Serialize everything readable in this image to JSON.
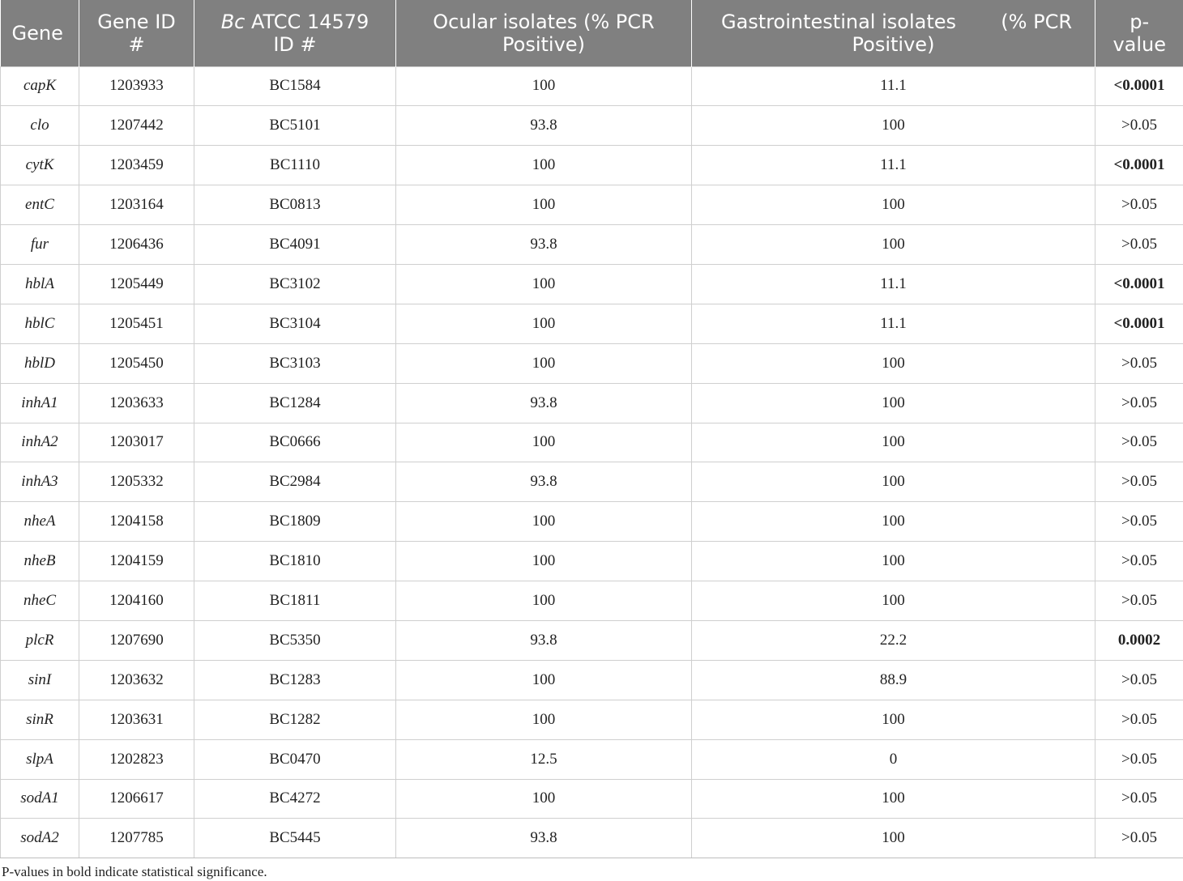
{
  "headers": {
    "gene": "Gene",
    "gene_id_line1": "Gene ID",
    "gene_id_line2": "#",
    "bc_italic": "Bc",
    "bc_rest": " ATCC 14579",
    "bc_line2": "ID #",
    "ocular_line1": "Ocular isolates (% PCR",
    "ocular_line2": "Positive)",
    "gi_part1": "Gastrointestinal isolates",
    "gi_part2": "(% PCR",
    "gi_line2": "Positive)",
    "p_line1": "p-",
    "p_line2": "value"
  },
  "rows": [
    {
      "gene": "capK",
      "gene_id": "1203933",
      "bc_id": "BC1584",
      "ocular": "100",
      "gi": "11.1",
      "p": "<0.0001",
      "significant": true
    },
    {
      "gene": "clo",
      "gene_id": "1207442",
      "bc_id": "BC5101",
      "ocular": "93.8",
      "gi": "100",
      "p": ">0.05",
      "significant": false
    },
    {
      "gene": "cytK",
      "gene_id": "1203459",
      "bc_id": "BC1110",
      "ocular": "100",
      "gi": "11.1",
      "p": "<0.0001",
      "significant": true
    },
    {
      "gene": "entC",
      "gene_id": "1203164",
      "bc_id": "BC0813",
      "ocular": "100",
      "gi": "100",
      "p": ">0.05",
      "significant": false
    },
    {
      "gene": "fur",
      "gene_id": "1206436",
      "bc_id": "BC4091",
      "ocular": "93.8",
      "gi": "100",
      "p": ">0.05",
      "significant": false
    },
    {
      "gene": "hblA",
      "gene_id": "1205449",
      "bc_id": "BC3102",
      "ocular": "100",
      "gi": "11.1",
      "p": "<0.0001",
      "significant": true
    },
    {
      "gene": "hblC",
      "gene_id": "1205451",
      "bc_id": "BC3104",
      "ocular": "100",
      "gi": "11.1",
      "p": "<0.0001",
      "significant": true
    },
    {
      "gene": "hblD",
      "gene_id": "1205450",
      "bc_id": "BC3103",
      "ocular": "100",
      "gi": "100",
      "p": ">0.05",
      "significant": false
    },
    {
      "gene": "inhA1",
      "gene_id": "1203633",
      "bc_id": "BC1284",
      "ocular": "93.8",
      "gi": "100",
      "p": ">0.05",
      "significant": false
    },
    {
      "gene": "inhA2",
      "gene_id": "1203017",
      "bc_id": "BC0666",
      "ocular": "100",
      "gi": "100",
      "p": ">0.05",
      "significant": false
    },
    {
      "gene": "inhA3",
      "gene_id": "1205332",
      "bc_id": "BC2984",
      "ocular": "93.8",
      "gi": "100",
      "p": ">0.05",
      "significant": false
    },
    {
      "gene": "nheA",
      "gene_id": "1204158",
      "bc_id": "BC1809",
      "ocular": "100",
      "gi": "100",
      "p": ">0.05",
      "significant": false
    },
    {
      "gene": "nheB",
      "gene_id": "1204159",
      "bc_id": "BC1810",
      "ocular": "100",
      "gi": "100",
      "p": ">0.05",
      "significant": false
    },
    {
      "gene": "nheC",
      "gene_id": "1204160",
      "bc_id": "BC1811",
      "ocular": "100",
      "gi": "100",
      "p": ">0.05",
      "significant": false
    },
    {
      "gene": "plcR",
      "gene_id": "1207690",
      "bc_id": "BC5350",
      "ocular": "93.8",
      "gi": "22.2",
      "p": "0.0002",
      "significant": true
    },
    {
      "gene": "sinI",
      "gene_id": "1203632",
      "bc_id": "BC1283",
      "ocular": "100",
      "gi": "88.9",
      "p": ">0.05",
      "significant": false
    },
    {
      "gene": "sinR",
      "gene_id": "1203631",
      "bc_id": "BC1282",
      "ocular": "100",
      "gi": "100",
      "p": ">0.05",
      "significant": false
    },
    {
      "gene": "slpA",
      "gene_id": "1202823",
      "bc_id": "BC0470",
      "ocular": "12.5",
      "gi": "0",
      "p": ">0.05",
      "significant": false
    },
    {
      "gene": "sodA1",
      "gene_id": "1206617",
      "bc_id": "BC4272",
      "ocular": "100",
      "gi": "100",
      "p": ">0.05",
      "significant": false
    },
    {
      "gene": "sodA2",
      "gene_id": "1207785",
      "bc_id": "BC5445",
      "ocular": "93.8",
      "gi": "100",
      "p": ">0.05",
      "significant": false
    }
  ],
  "footnote": "P-values in bold indicate statistical significance."
}
